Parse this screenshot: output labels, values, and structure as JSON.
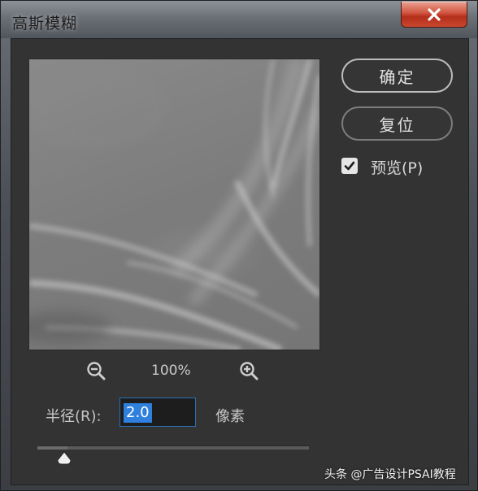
{
  "window": {
    "title": "高斯模糊"
  },
  "preview": {
    "zoom_level": "100%"
  },
  "radius": {
    "label": "半径(R):",
    "value": "2.0",
    "unit": "像素",
    "slider_fraction": 0.11
  },
  "buttons": {
    "ok_label": "确定",
    "reset_label": "复位"
  },
  "preview_toggle": {
    "label": "预览(P)",
    "checked": true
  },
  "watermark": {
    "text": "头条 @广告设计PSAI教程"
  },
  "colors": {
    "accent": "#2f7fdc",
    "close_button": "#c9462e",
    "panel_bg": "#333333"
  },
  "icons": [
    "close-icon",
    "zoom-out-icon",
    "zoom-in-icon",
    "checkmark-icon",
    "slider-thumb-icon"
  ]
}
